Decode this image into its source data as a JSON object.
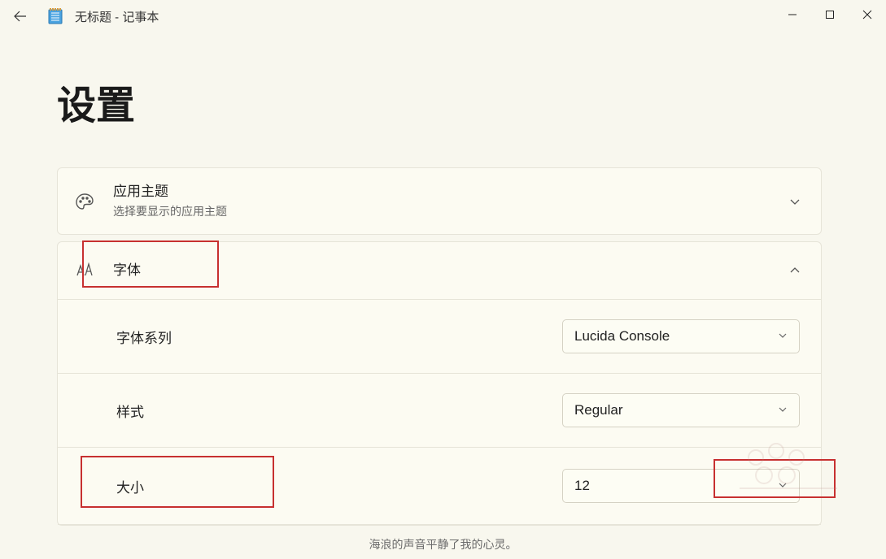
{
  "window": {
    "title": "无标题 - 记事本"
  },
  "page": {
    "title": "设置"
  },
  "theme_card": {
    "title": "应用主题",
    "subtitle": "选择要显示的应用主题"
  },
  "font_card": {
    "title": "字体",
    "family_label": "字体系列",
    "family_value": "Lucida Console",
    "style_label": "样式",
    "style_value": "Regular",
    "size_label": "大小",
    "size_value": "12"
  },
  "footer": "海浪的声音平静了我的心灵。"
}
